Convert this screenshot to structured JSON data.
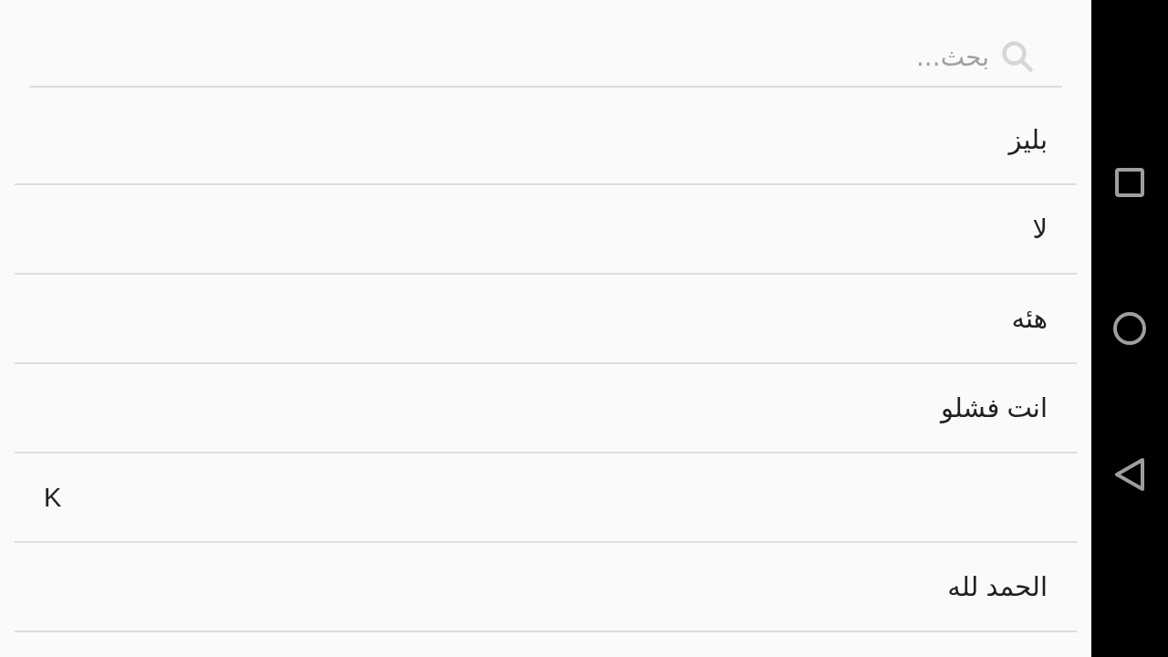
{
  "search": {
    "placeholder": "بحث..."
  },
  "list": {
    "items": [
      "بليز",
      "لا",
      "هئه",
      "انت فشلو",
      "K",
      "الحمد لله"
    ]
  }
}
